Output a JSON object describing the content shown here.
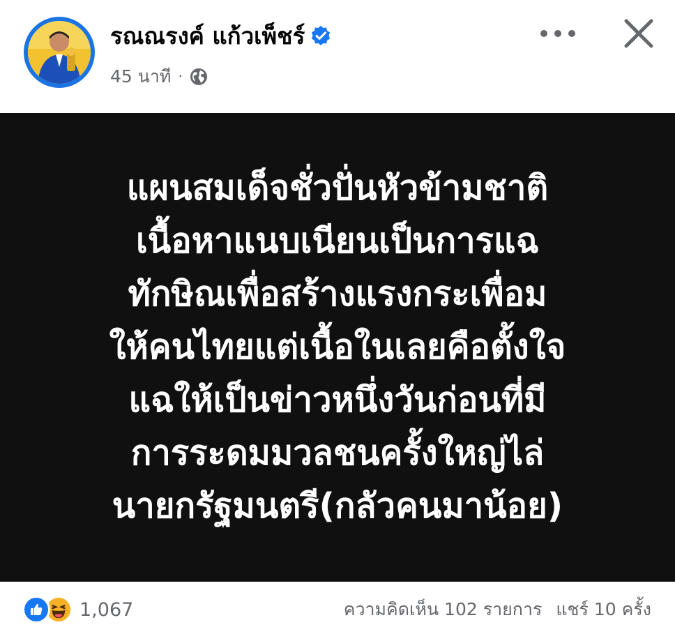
{
  "header": {
    "author_name": "รณณรงค์ แก้วเพ็ชร์",
    "time_ago": "45 นาที",
    "separator": "·",
    "privacy_icon": "globe-icon",
    "verified_icon": "verified-badge-icon",
    "more_icon": "more-horizontal-icon",
    "close_icon": "close-icon"
  },
  "post": {
    "background": "#101010",
    "text_color": "#ffffff",
    "lines": [
      "แผนสมเด็จชั่วปั่นหัวข้ามชาติ",
      "เนื้อหาแนบเนียนเป็นการแฉ",
      "ทักษิณเพื่อสร้างแรงกระเพื่อม",
      "ให้คนไทยแต่เนื้อในเลยคือตั้งใจ",
      "แฉให้เป็นข่าวหนึ่งวันก่อนที่มี",
      "การระดมมวลชนครั้งใหญ่ไล่",
      "นายกรัฐมนตรี(กลัวคนมาน้อย)"
    ]
  },
  "footer": {
    "reaction_icons": [
      "like-icon",
      "haha-icon"
    ],
    "reaction_count": "1,067",
    "comments": "ความคิดเห็น 102 รายการ",
    "shares": "แชร์ 10 ครั้ง"
  },
  "colors": {
    "accent": "#1877f2",
    "secondary_text": "#65676b",
    "avatar_ring": "#1b74e4"
  }
}
